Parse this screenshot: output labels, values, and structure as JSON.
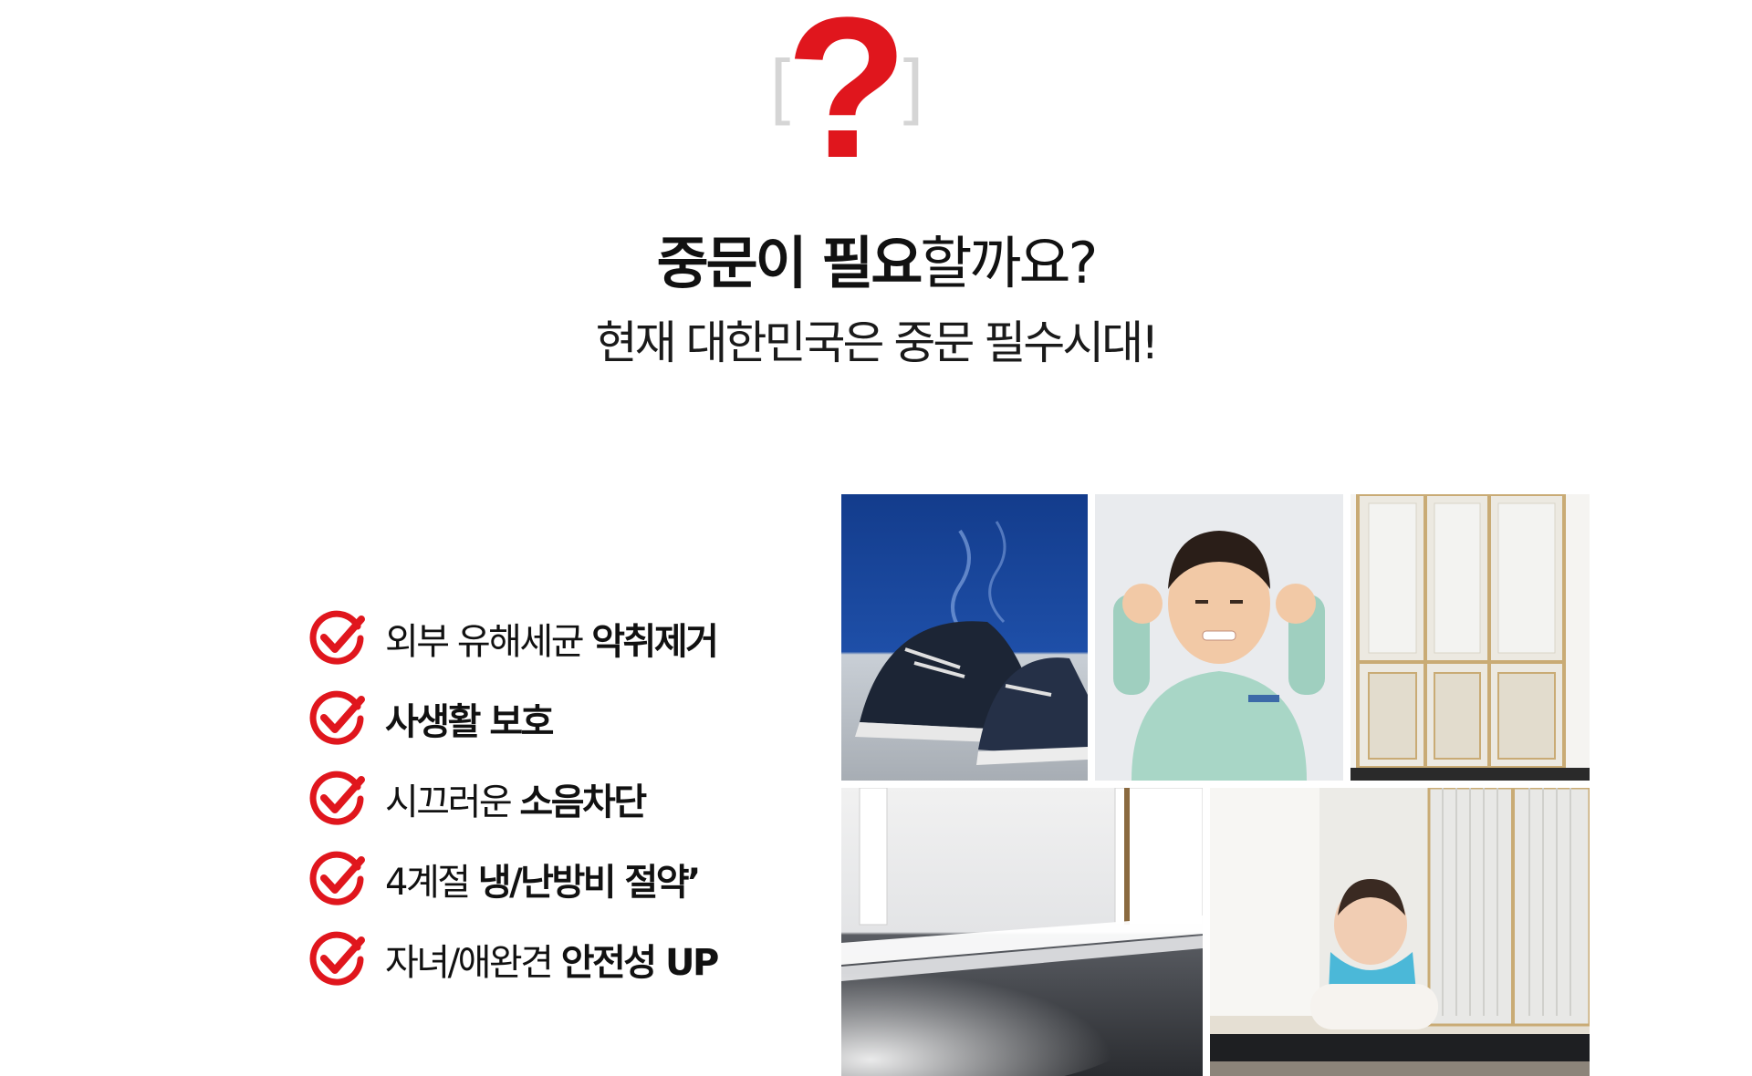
{
  "header": {
    "question_mark": "?",
    "bracket_left": "[",
    "bracket_right": "]",
    "accent_color": "#e0161d"
  },
  "headline": {
    "bold_part": "중문이 필요",
    "light_part": "할까요?"
  },
  "subline": "현재 대한민국은 중문 필수시대!",
  "checklist": [
    {
      "icon": "red-check-circle-icon",
      "normal": "외부 유해세균 ",
      "bold": "악취제거"
    },
    {
      "icon": "red-check-circle-icon",
      "normal": "",
      "bold": "사생활 보호"
    },
    {
      "icon": "red-check-circle-icon",
      "normal": "시끄러운 ",
      "bold": "소음차단"
    },
    {
      "icon": "red-check-circle-icon",
      "normal": "4계절 ",
      "bold": "냉/난방비 절약’"
    },
    {
      "icon": "red-check-circle-icon",
      "normal": "자녀/애완견 ",
      "bold": "안전성 UP"
    }
  ],
  "photos": [
    {
      "name": "smelly-sneakers-photo"
    },
    {
      "name": "boy-covering-ears-photo"
    },
    {
      "name": "gold-frame-door-photo"
    },
    {
      "name": "cold-air-door-gap-photo"
    },
    {
      "name": "crawling-baby-door-photo"
    }
  ]
}
